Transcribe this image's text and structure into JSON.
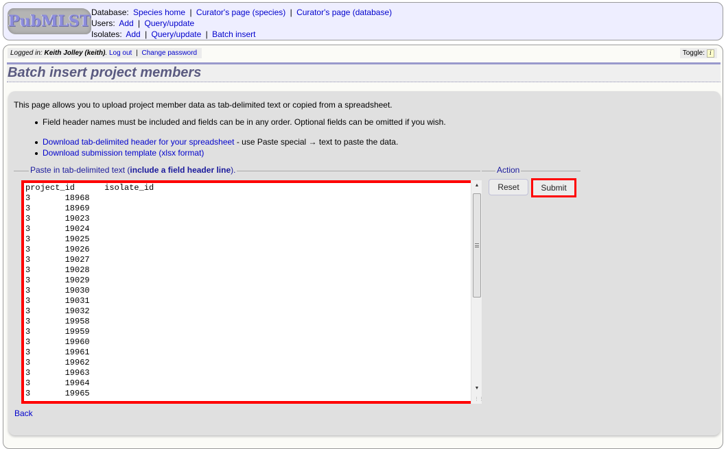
{
  "header": {
    "logo_text": "PubMLST",
    "menu": [
      {
        "label": "Database:",
        "links": [
          "Species home",
          "Curator's page (species)",
          "Curator's page (database)"
        ]
      },
      {
        "label": "Users:",
        "links": [
          "Add",
          "Query/update"
        ]
      },
      {
        "label": "Isolates:",
        "links": [
          "Add",
          "Query/update",
          "Batch insert"
        ]
      }
    ],
    "separator": "|"
  },
  "login": {
    "prefix": "Logged in: ",
    "user": "Keith Jolley (keith)",
    "suffix": ".",
    "logout": "Log out",
    "change_password": "Change password"
  },
  "toggle": {
    "label": "Toggle:",
    "icon_glyph": "i"
  },
  "page_title": "Batch insert project members",
  "intro": "This page allows you to upload project member data as tab-delimited text or copied from a spreadsheet.",
  "bullets_1": [
    "Field header names must be included and fields can be in any order. Optional fields can be omitted if you wish."
  ],
  "bullets_2": [
    {
      "link": "Download tab-delimited header for your spreadsheet",
      "text": " - use Paste special → text to paste the data."
    },
    {
      "link": "Download submission template (xlsx format)",
      "text": ""
    }
  ],
  "paste_fieldset": {
    "legend_prefix": "Paste in tab-delimited text (",
    "legend_bold": "include a field header line",
    "legend_suffix": ")."
  },
  "textarea": {
    "header": [
      "project_id",
      "isolate_id"
    ],
    "rows": [
      [
        "3",
        "18968"
      ],
      [
        "3",
        "18969"
      ],
      [
        "3",
        "19023"
      ],
      [
        "3",
        "19024"
      ],
      [
        "3",
        "19025"
      ],
      [
        "3",
        "19026"
      ],
      [
        "3",
        "19027"
      ],
      [
        "3",
        "19028"
      ],
      [
        "3",
        "19029"
      ],
      [
        "3",
        "19030"
      ],
      [
        "3",
        "19031"
      ],
      [
        "3",
        "19032"
      ],
      [
        "3",
        "19958"
      ],
      [
        "3",
        "19959"
      ],
      [
        "3",
        "19960"
      ],
      [
        "3",
        "19961"
      ],
      [
        "3",
        "19962"
      ],
      [
        "3",
        "19963"
      ],
      [
        "3",
        "19964"
      ],
      [
        "3",
        "19965"
      ]
    ]
  },
  "action_fieldset": {
    "legend": "Action",
    "reset_label": "Reset",
    "submit_label": "Submit"
  },
  "back_link": "Back",
  "colors": {
    "highlight": "#ff0000",
    "link": "#0000cc",
    "title": "#5a5a80",
    "menu_bg": "#eeeeff"
  }
}
